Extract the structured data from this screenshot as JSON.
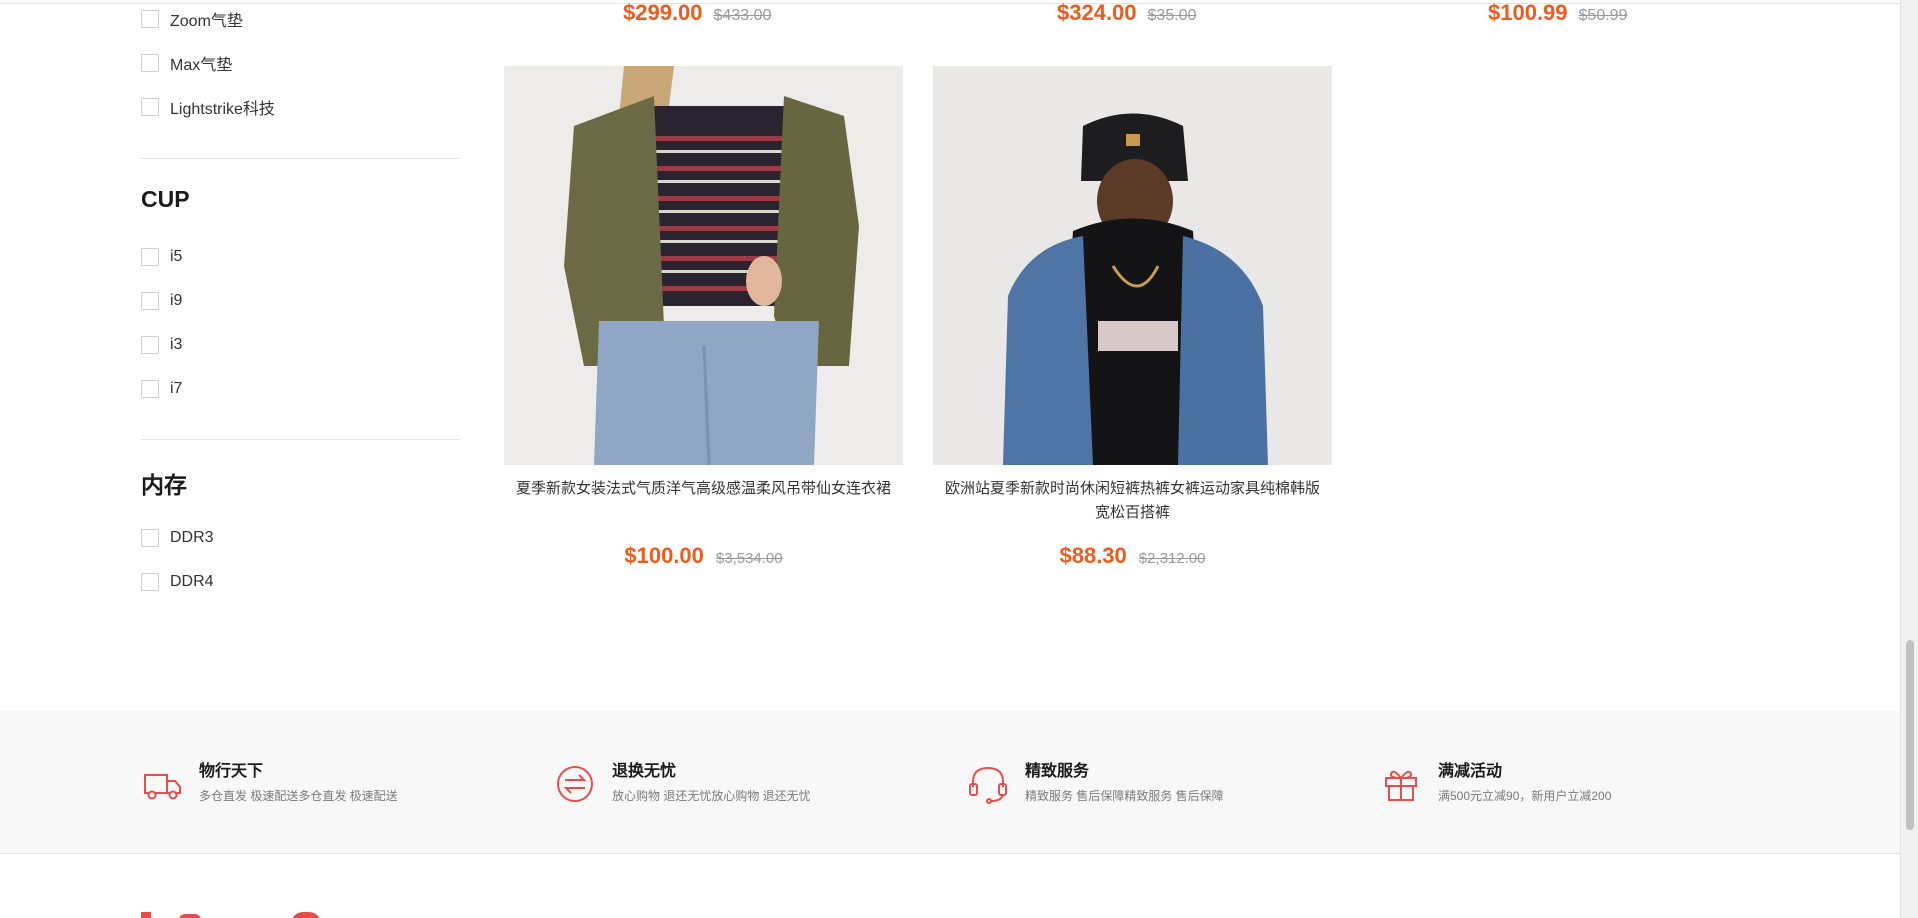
{
  "filters": {
    "tech_items": [
      "Zoom气垫",
      "Max气垫",
      "Lightstrike科技"
    ],
    "cpu": {
      "title": "CUP",
      "items": [
        "i5",
        "i9",
        "i3",
        "i7"
      ]
    },
    "memory": {
      "title": "内存",
      "items": [
        "DDR3",
        "DDR4"
      ]
    }
  },
  "top_prices": [
    {
      "now": "$299.00",
      "old": "$433.00"
    },
    {
      "now": "$324.00",
      "old": "$35.00"
    },
    {
      "now": "$100.99",
      "old": "$50.99"
    }
  ],
  "products": [
    {
      "title": "夏季新款女装法式气质洋气高级感温柔风吊带仙女连衣裙",
      "price": "$100.00",
      "old_price": "$3,534.00"
    },
    {
      "title": "欧洲站夏季新款时尚休闲短裤热裤女裤运动家具纯棉韩版宽松百搭裤",
      "price": "$88.30",
      "old_price": "$2,312.00"
    }
  ],
  "services": [
    {
      "icon": "delivery-truck-icon",
      "title": "物行天下",
      "desc": "多仓直发 极速配送多仓直发 极速配送"
    },
    {
      "icon": "exchange-icon",
      "title": "退换无忧",
      "desc": "放心购物 退还无忧放心购物 退还无忧"
    },
    {
      "icon": "headset-icon",
      "title": "精致服务",
      "desc": "精致服务 售后保障精致服务 售后保障"
    },
    {
      "icon": "gift-icon",
      "title": "满减活动",
      "desc": "满500元立减90，新用户立减200"
    }
  ],
  "colors": {
    "accent": "#f25a1c",
    "icon": "#e84d4d"
  }
}
